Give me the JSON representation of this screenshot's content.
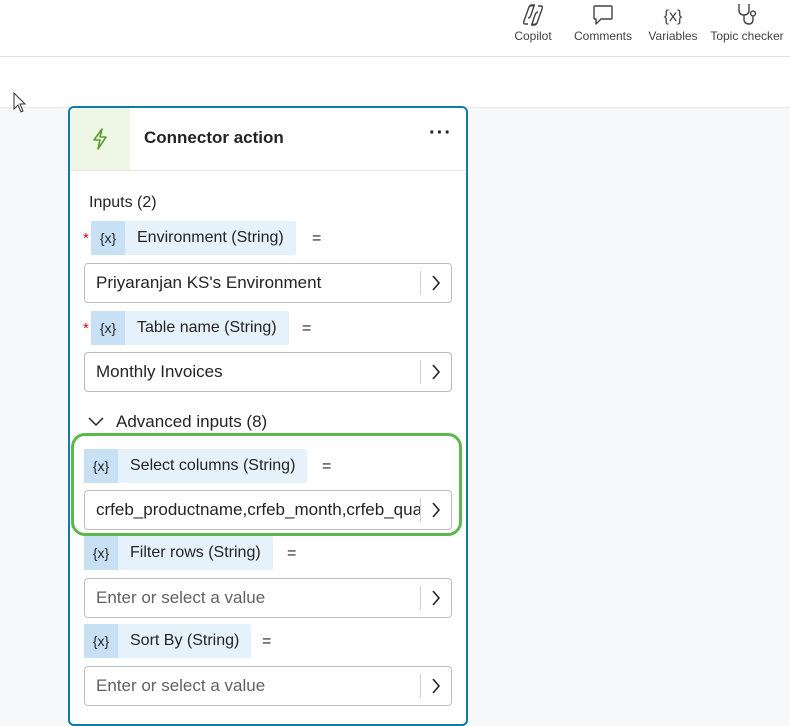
{
  "toolbar": {
    "items": [
      {
        "label": "Copilot",
        "icon": "copilot-icon"
      },
      {
        "label": "Comments",
        "icon": "comment-icon"
      },
      {
        "label": "Variables",
        "icon": "variables-icon",
        "glyph": "{x}"
      },
      {
        "label": "Topic checker",
        "icon": "stethoscope-icon"
      }
    ]
  },
  "card": {
    "title": "Connector action",
    "more": "···",
    "icon": "lightning-bolt-icon",
    "accent": "#117aa5",
    "inputs_title": "Inputs (2)",
    "advanced_title": "Advanced inputs (8)",
    "var_glyph": "{x}",
    "equals": "=",
    "required_mark": "*",
    "inputs": [
      {
        "name": "Environment (String)",
        "value": "Priyaranjan KS's Environment"
      },
      {
        "name": "Table name (String)",
        "value": "Monthly Invoices"
      }
    ],
    "advanced": [
      {
        "name": "Select columns (String)",
        "value": "crfeb_productname,crfeb_month,crfeb_quantity"
      },
      {
        "name": "Filter rows (String)",
        "placeholder": "Enter or select a value"
      },
      {
        "name": "Sort By (String)",
        "placeholder": "Enter or select a value"
      }
    ]
  },
  "colors": {
    "highlight": "#5cb84a",
    "chip": "#e5f1fb",
    "chip_icon": "#c7e0f4",
    "required": "#c50f1f"
  }
}
